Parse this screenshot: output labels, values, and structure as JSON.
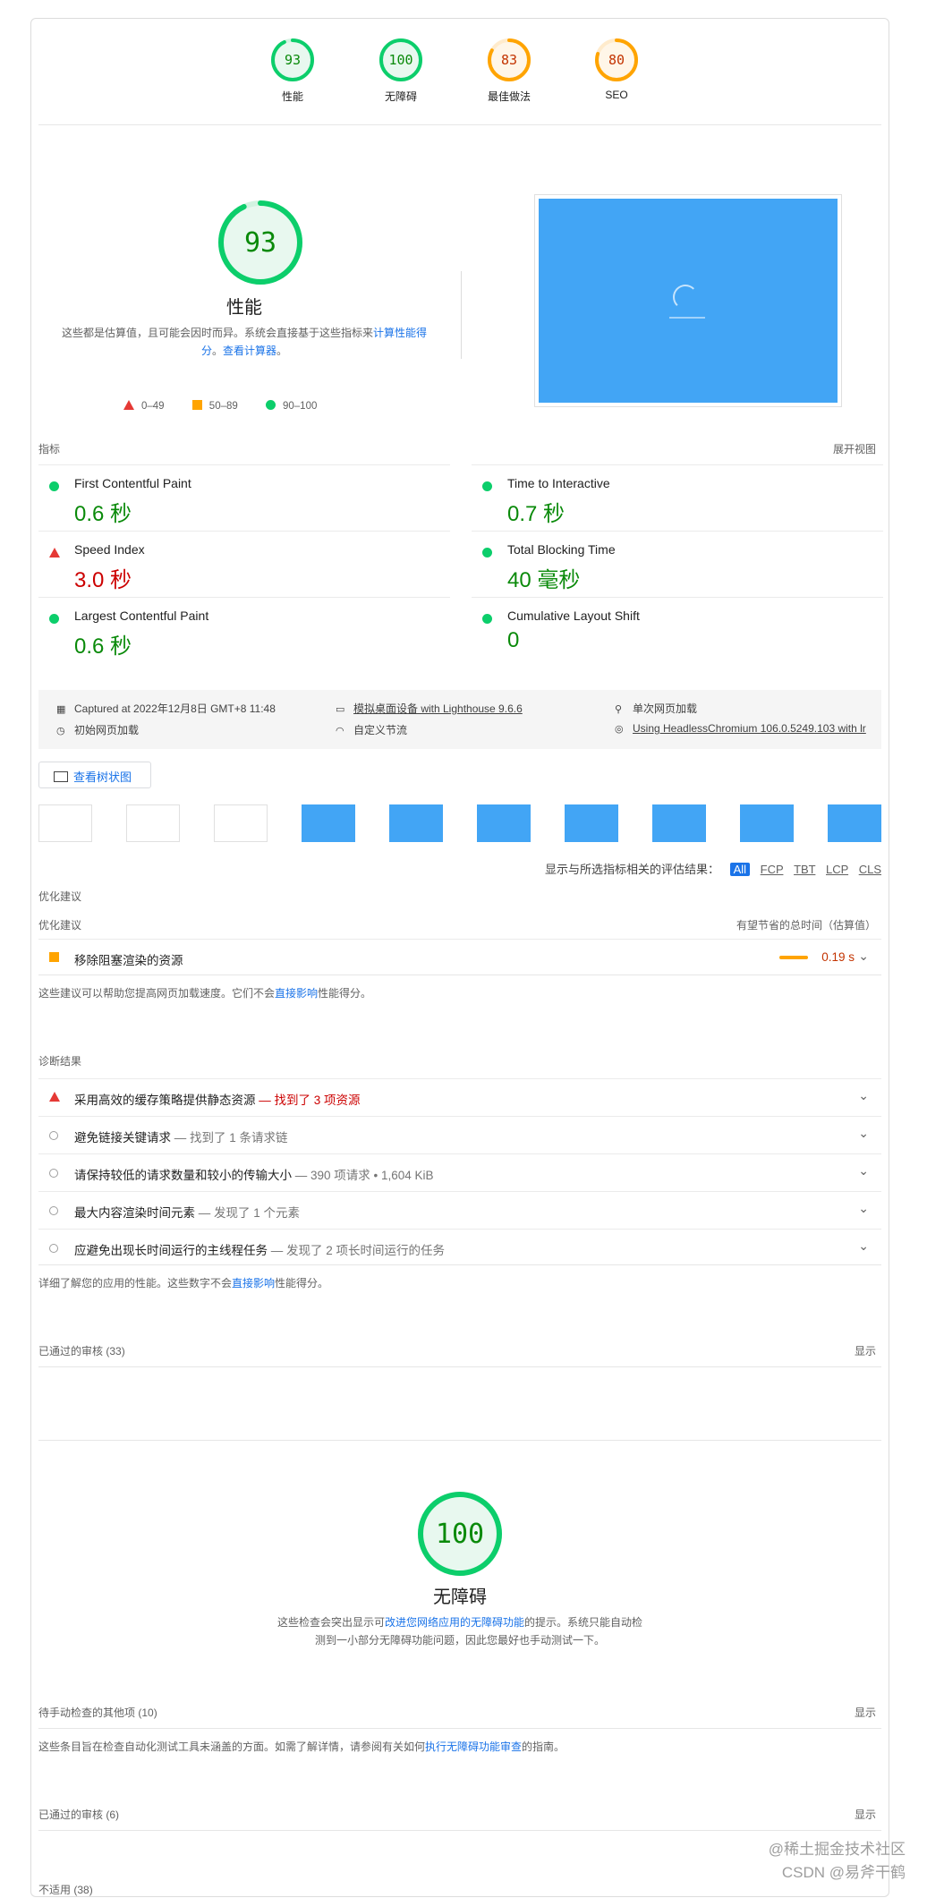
{
  "top_scores": [
    {
      "score": "93",
      "label": "性能",
      "color": "#0cce6b",
      "text_color": "#0a8a0a",
      "fraction": 0.93
    },
    {
      "score": "100",
      "label": "无障碍",
      "color": "#0cce6b",
      "text_color": "#0a8a0a",
      "fraction": 1.0
    },
    {
      "score": "83",
      "label": "最佳做法",
      "color": "#ffa400",
      "text_color": "#c33300",
      "fraction": 0.83
    },
    {
      "score": "80",
      "label": "SEO",
      "color": "#ffa400",
      "text_color": "#c33300",
      "fraction": 0.8
    }
  ],
  "performance": {
    "score": "93",
    "fraction": 0.93,
    "title": "性能",
    "desc_before": "这些都是估算值，且可能会因时而异。系统会直接基于这些指标来",
    "desc_link1": "计算性能得分",
    "desc_mid": "。",
    "desc_link2": "查看计算器",
    "desc_end": "。",
    "legend": [
      "0–49",
      "50–89",
      "90–100"
    ]
  },
  "metrics_header": {
    "left": "指标",
    "right": "展开视图"
  },
  "metrics": [
    {
      "name": "First Contentful Paint",
      "value": "0.6 秒",
      "status": "pass"
    },
    {
      "name": "Time to Interactive",
      "value": "0.7 秒",
      "status": "pass"
    },
    {
      "name": "Speed Index",
      "value": "3.0 秒",
      "status": "fail"
    },
    {
      "name": "Total Blocking Time",
      "value": "40 毫秒",
      "status": "pass"
    },
    {
      "name": "Largest Contentful Paint",
      "value": "0.6 秒",
      "status": "pass"
    },
    {
      "name": "Cumulative Layout Shift",
      "value": "0",
      "status": "pass"
    }
  ],
  "env": {
    "captured": "Captured at 2022年12月8日 GMT+8 11:48",
    "device": "模拟桌面设备 with Lighthouse 9.6.6",
    "session": "单次网页加载",
    "load": "初始网页加载",
    "throttle": "自定义节流",
    "browser": "Using HeadlessChromium 106.0.5249.103 with lr"
  },
  "tree_button": "查看树状图",
  "filter": {
    "label": "显示与所选指标相关的评估结果：",
    "options": [
      "All",
      "FCP",
      "TBT",
      "LCP",
      "CLS"
    ]
  },
  "opportunities": {
    "section": "优化建议",
    "col_left": "优化建议",
    "col_right": "有望节省的总时间（估算值）",
    "items": [
      {
        "title": "移除阻塞渲染的资源",
        "savings": "0.19 s"
      }
    ],
    "note_before": "这些建议可以帮助您提高网页加载速度。它们不会",
    "note_link": "直接影响",
    "note_after": "性能得分。"
  },
  "diagnostics": {
    "section": "诊断结果",
    "items": [
      {
        "title": "采用高效的缓存策略提供静态资源",
        "detail": "— 找到了 3 项资源",
        "status": "fail"
      },
      {
        "title": "避免链接关键请求",
        "detail": "— 找到了 1 条请求链",
        "status": "info"
      },
      {
        "title": "请保持较低的请求数量和较小的传输大小",
        "detail": "— 390 项请求 • 1,604 KiB",
        "status": "info"
      },
      {
        "title": "最大内容渲染时间元素",
        "detail": "— 发现了 1 个元素",
        "status": "info"
      },
      {
        "title": "应避免出现长时间运行的主线程任务",
        "detail": "— 发现了 2 项长时间运行的任务",
        "status": "info"
      }
    ],
    "note_before": "详细了解您的应用的性能。这些数字不会",
    "note_link": "直接影响",
    "note_after": "性能得分。"
  },
  "passed_perf": {
    "label": "已通过的审核",
    "count": "(33)",
    "action": "显示"
  },
  "accessibility": {
    "score": "100",
    "fraction": 1.0,
    "title": "无障碍",
    "desc_before": "这些检查会突出显示可",
    "desc_link": "改进您网络应用的无障碍功能",
    "desc_after": "的提示。系统只能自动检测到一小部分无障碍功能问题，因此您最好也手动测试一下。"
  },
  "manual": {
    "label": "待手动检查的其他项",
    "count": "(10)",
    "action": "显示",
    "note_before": "这些条目旨在检查自动化测试工具未涵盖的方面。如需了解详情，请参阅有关如何",
    "note_link": "执行无障碍功能审查",
    "note_after": "的指南。"
  },
  "passed_acc": {
    "label": "已通过的审核",
    "count": "(6)",
    "action": "显示"
  },
  "not_applicable": {
    "label": "不适用",
    "count": "(38)"
  },
  "watermark": {
    "line1": "@稀土掘金技术社区",
    "line2": "CSDN @易斧干鹤"
  }
}
